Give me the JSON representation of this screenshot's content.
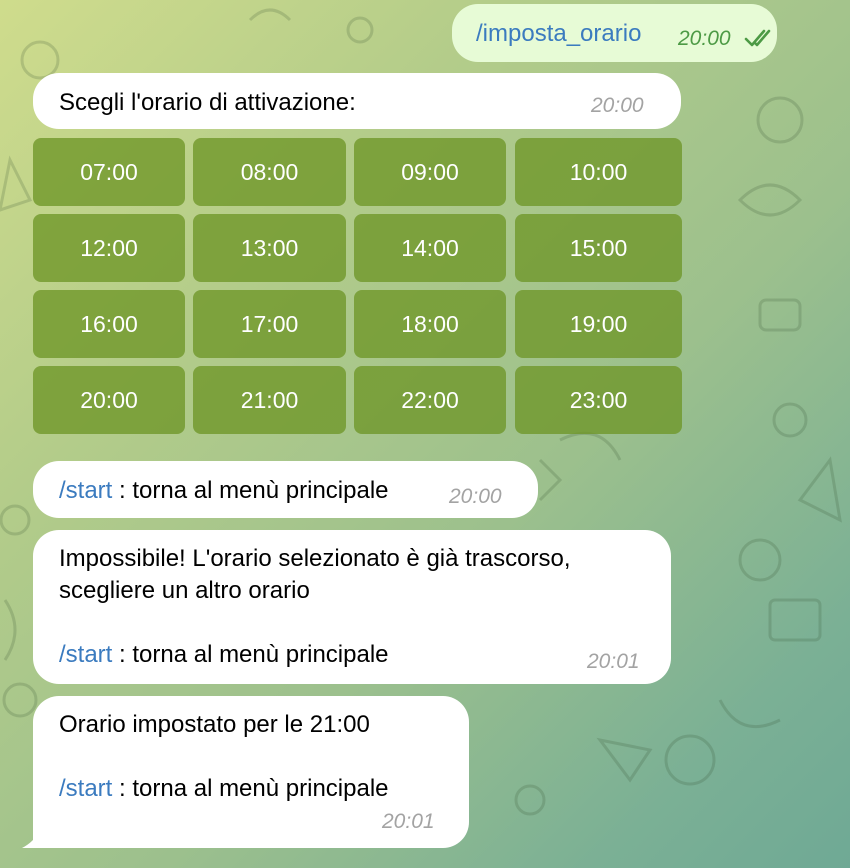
{
  "sent_message": {
    "text": "/imposta_orario",
    "time": "20:00",
    "status_icon": "double-check-icon"
  },
  "prompt_message": {
    "text": "Scegli l'orario di attivazione:",
    "time": "20:00"
  },
  "keyboard": [
    [
      "07:00",
      "08:00",
      "09:00",
      "10:00"
    ],
    [
      "12:00",
      "13:00",
      "14:00",
      "15:00"
    ],
    [
      "16:00",
      "17:00",
      "18:00",
      "19:00"
    ],
    [
      "20:00",
      "21:00",
      "22:00",
      "23:00"
    ]
  ],
  "start_message": {
    "command": "/start",
    "text": " : torna al menù principale",
    "time": "20:00"
  },
  "error_message": {
    "line1": "Impossibile! L'orario selezionato è già trascorso,",
    "line2": "scegliere un altro orario",
    "command": "/start",
    "text": " : torna al menù principale",
    "time": "20:01"
  },
  "confirm_message": {
    "line1": "Orario impostato per le 21:00",
    "command": "/start",
    "text": " : torna al menù principale",
    "time": "20:01"
  },
  "colors": {
    "outgoing_bubble": "#e7fbd6",
    "incoming_bubble": "#ffffff",
    "link": "#3b7bbf",
    "keyboard_button": "#7c9a3a"
  }
}
